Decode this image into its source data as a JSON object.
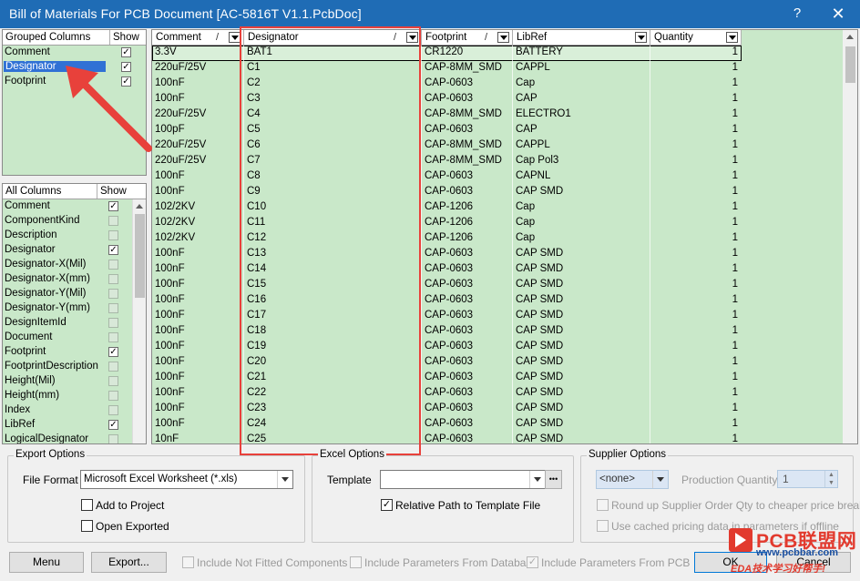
{
  "window": {
    "title": "Bill of Materials For PCB Document [AC-5816T V1.1.PcbDoc]",
    "help_label": "?",
    "close_label": "✕"
  },
  "grouped_columns": {
    "header": "Grouped Columns",
    "show_header": "Show",
    "items": [
      {
        "label": "Comment",
        "checked": true
      },
      {
        "label": "Designator",
        "checked": true,
        "selected": true
      },
      {
        "label": "Footprint",
        "checked": true
      }
    ]
  },
  "all_columns": {
    "header": "All Columns",
    "show_header": "Show",
    "items": [
      {
        "label": "Comment",
        "checked": true
      },
      {
        "label": "ComponentKind",
        "checked": false
      },
      {
        "label": "Description",
        "checked": false
      },
      {
        "label": "Designator",
        "checked": true
      },
      {
        "label": "Designator-X(Mil)",
        "checked": false
      },
      {
        "label": "Designator-X(mm)",
        "checked": false
      },
      {
        "label": "Designator-Y(Mil)",
        "checked": false
      },
      {
        "label": "Designator-Y(mm)",
        "checked": false
      },
      {
        "label": "DesignItemId",
        "checked": false
      },
      {
        "label": "Document",
        "checked": false
      },
      {
        "label": "Footprint",
        "checked": true
      },
      {
        "label": "FootprintDescription",
        "checked": false
      },
      {
        "label": "Height(Mil)",
        "checked": false
      },
      {
        "label": "Height(mm)",
        "checked": false
      },
      {
        "label": "Index",
        "checked": false
      },
      {
        "label": "LibRef",
        "checked": true
      },
      {
        "label": "LogicalDesignator",
        "checked": false
      }
    ]
  },
  "grid": {
    "columns": [
      {
        "label": "Comment",
        "sort": "/"
      },
      {
        "label": "Designator",
        "sort": "/"
      },
      {
        "label": "Footprint",
        "sort": "/"
      },
      {
        "label": "LibRef",
        "sort": ""
      },
      {
        "label": "Quantity",
        "sort": ""
      }
    ],
    "rows": [
      [
        "3.3V",
        "BAT1",
        "CR1220",
        "BATTERY",
        "1"
      ],
      [
        "220uF/25V",
        "C1",
        "CAP-8MM_SMD",
        "CAPPL",
        "1"
      ],
      [
        "100nF",
        "C2",
        "CAP-0603",
        "Cap",
        "1"
      ],
      [
        "100nF",
        "C3",
        "CAP-0603",
        "CAP",
        "1"
      ],
      [
        "220uF/25V",
        "C4",
        "CAP-8MM_SMD",
        "ELECTRO1",
        "1"
      ],
      [
        "100pF",
        "C5",
        "CAP-0603",
        "CAP",
        "1"
      ],
      [
        "220uF/25V",
        "C6",
        "CAP-8MM_SMD",
        "CAPPL",
        "1"
      ],
      [
        "220uF/25V",
        "C7",
        "CAP-8MM_SMD",
        "Cap Pol3",
        "1"
      ],
      [
        "100nF",
        "C8",
        "CAP-0603",
        "CAPNL",
        "1"
      ],
      [
        "100nF",
        "C9",
        "CAP-0603",
        "CAP SMD",
        "1"
      ],
      [
        "102/2KV",
        "C10",
        "CAP-1206",
        "Cap",
        "1"
      ],
      [
        "102/2KV",
        "C11",
        "CAP-1206",
        "Cap",
        "1"
      ],
      [
        "102/2KV",
        "C12",
        "CAP-1206",
        "Cap",
        "1"
      ],
      [
        "100nF",
        "C13",
        "CAP-0603",
        "CAP SMD",
        "1"
      ],
      [
        "100nF",
        "C14",
        "CAP-0603",
        "CAP SMD",
        "1"
      ],
      [
        "100nF",
        "C15",
        "CAP-0603",
        "CAP SMD",
        "1"
      ],
      [
        "100nF",
        "C16",
        "CAP-0603",
        "CAP SMD",
        "1"
      ],
      [
        "100nF",
        "C17",
        "CAP-0603",
        "CAP SMD",
        "1"
      ],
      [
        "100nF",
        "C18",
        "CAP-0603",
        "CAP SMD",
        "1"
      ],
      [
        "100nF",
        "C19",
        "CAP-0603",
        "CAP SMD",
        "1"
      ],
      [
        "100nF",
        "C20",
        "CAP-0603",
        "CAP SMD",
        "1"
      ],
      [
        "100nF",
        "C21",
        "CAP-0603",
        "CAP SMD",
        "1"
      ],
      [
        "100nF",
        "C22",
        "CAP-0603",
        "CAP SMD",
        "1"
      ],
      [
        "100nF",
        "C23",
        "CAP-0603",
        "CAP SMD",
        "1"
      ],
      [
        "100nF",
        "C24",
        "CAP-0603",
        "CAP SMD",
        "1"
      ],
      [
        "10nF",
        "C25",
        "CAP-0603",
        "CAP SMD",
        "1"
      ]
    ]
  },
  "export_options": {
    "legend": "Export Options",
    "file_format_label": "File Format",
    "file_format_value": "Microsoft Excel Worksheet (*.xls)",
    "add_to_project_label": "Add to Project",
    "open_exported_label": "Open Exported"
  },
  "excel_options": {
    "legend": "Excel Options",
    "template_label": "Template",
    "template_value": "",
    "browse_label": "•••",
    "relative_path_label": "Relative Path to Template File"
  },
  "supplier_options": {
    "legend": "Supplier Options",
    "supplier_value": "<none>",
    "production_qty_label": "Production Quantity",
    "production_qty_value": "1",
    "round_up_label": "Round up Supplier Order Qty to cheaper price break",
    "cached_label": "Use cached pricing data in parameters if offline"
  },
  "bottom_bar": {
    "menu_label": "Menu",
    "export_label": "Export...",
    "not_fitted_label": "Include Not Fitted Components",
    "params_db_label": "Include Parameters From Database",
    "params_pcb_label": "Include Parameters From PCB",
    "ok_label": "OK",
    "cancel_label": "Cancel"
  },
  "watermark": {
    "brand": "PCB联盟网",
    "url": "www.pcbbar.com",
    "slogan": "EDA技术学习好帮手!"
  },
  "colors": {
    "grid_bg": "#c9e8c9",
    "titlebar": "#1f6cb5",
    "highlight_red": "#e8413b",
    "selection": "#3071d5"
  }
}
